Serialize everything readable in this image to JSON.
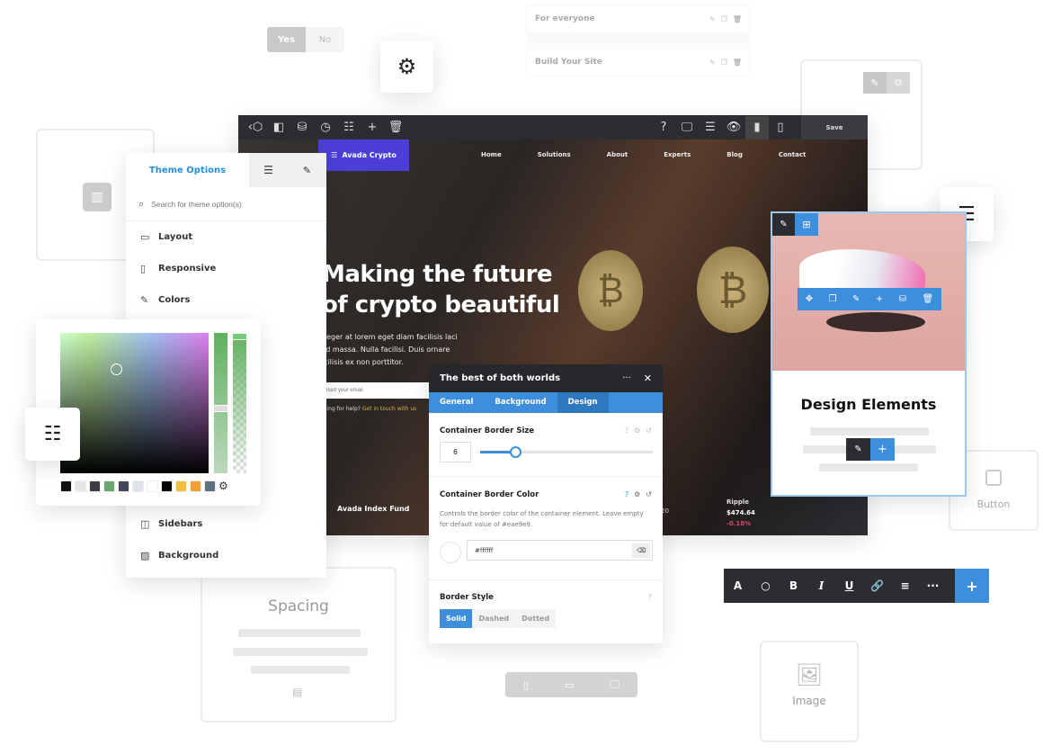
{
  "yes_no": {
    "yes": "Yes",
    "no": "No"
  },
  "top_list": [
    {
      "label": "For everyone"
    },
    {
      "label": "Build Your Site"
    }
  ],
  "editor": {
    "save": "Save",
    "logo": "Avada Crypto",
    "nav": [
      "Home",
      "Solutions",
      "About",
      "Experts",
      "Blog",
      "Contact"
    ],
    "hero_title_1": "Making the future",
    "hero_title_2": "of crypto beautiful",
    "hero_body": [
      "teger at lorem eget diam facilisis laci",
      "id massa. Nulla facilisi. Duis ornare",
      "cilisis ex non porttitor."
    ],
    "email_placeholder": "nsert your email",
    "help": "king for help?",
    "help_link": "Get in touch with us",
    "fund": "Avada Index Fund",
    "ticker_partial": "20",
    "ripple": {
      "name": "Ripple",
      "price": "$474.64",
      "change": "-0.18%"
    }
  },
  "theme_options": {
    "title": "Theme Options",
    "search_placeholder": "Search for theme option(s)",
    "items_top": [
      "Layout",
      "Responsive",
      "Colors"
    ],
    "items_bottom": [
      "Sidebars",
      "Background"
    ]
  },
  "color_picker": {
    "swatches": [
      "#111111",
      "#e6e6e6",
      "#3b3d42",
      "#6aa76f",
      "#45475a",
      "#dde3ec",
      "#ffffff",
      "#050505",
      "#f0c040",
      "#f0a030",
      "#5f7080"
    ]
  },
  "modal": {
    "title": "The best of both worlds",
    "tabs": [
      "General",
      "Background",
      "Design"
    ],
    "active_tab": "Design",
    "border_size_label": "Container Border Size",
    "border_size_value": "6",
    "border_size_fraction": 0.1,
    "border_color_label": "Container Border Color",
    "border_color_desc": "Controls the border color of the container element. Leave empty for default value of #eae9e9.",
    "border_color_value": "#ffffff",
    "border_style_label": "Border Style",
    "border_styles": [
      "Solid",
      "Dashed",
      "Dotted"
    ],
    "active_style": "Solid"
  },
  "product_card": {
    "title": "Design Elements"
  },
  "ghost": {
    "button": "Button",
    "spacing": "Spacing",
    "image": "Image"
  },
  "format_toolbar": {
    "items": [
      "A",
      "○",
      "B",
      "I",
      "U",
      "🔗",
      "≡",
      "···",
      "+"
    ]
  },
  "colors": {
    "accent": "#3d8fde",
    "purple": "#4b3fd8",
    "dark": "#26282c"
  }
}
